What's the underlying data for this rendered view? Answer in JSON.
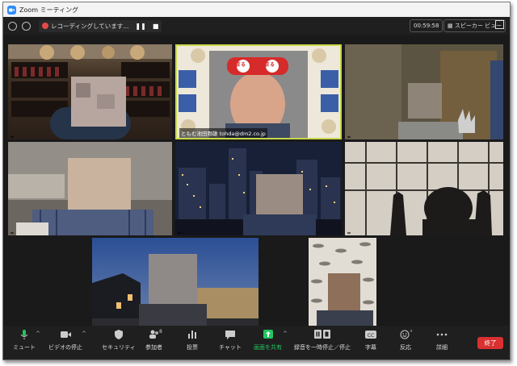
{
  "window": {
    "title": "Zoom ミーティング"
  },
  "status": {
    "recording_text": "レコーディングしています...",
    "timer": "00:59:58",
    "view_label": "スピーカー ビュー"
  },
  "participants": [
    {
      "name": ""
    },
    {
      "name": "ともむ池田剛雄 tohda@dm2.co.jp"
    },
    {
      "name": ""
    },
    {
      "name": ""
    },
    {
      "name": ""
    },
    {
      "name": ""
    },
    {
      "name": ""
    },
    {
      "name": ""
    }
  ],
  "banner": {
    "text_a": "まる",
    "text_b": "まる"
  },
  "toolbar": {
    "mute": "ミュート",
    "video": "ビデオの停止",
    "security": "セキュリティ",
    "participants": "参加者",
    "participants_count": "8",
    "polls": "投票",
    "chat": "チャット",
    "share": "画面を共有",
    "record": "録音を一時停止／停止",
    "captions": "字幕",
    "reactions": "反応",
    "more": "詳細",
    "end": "終了"
  },
  "colors": {
    "accent": "#2d8cff",
    "share_green": "#22c55e",
    "end_red": "#d93030"
  }
}
